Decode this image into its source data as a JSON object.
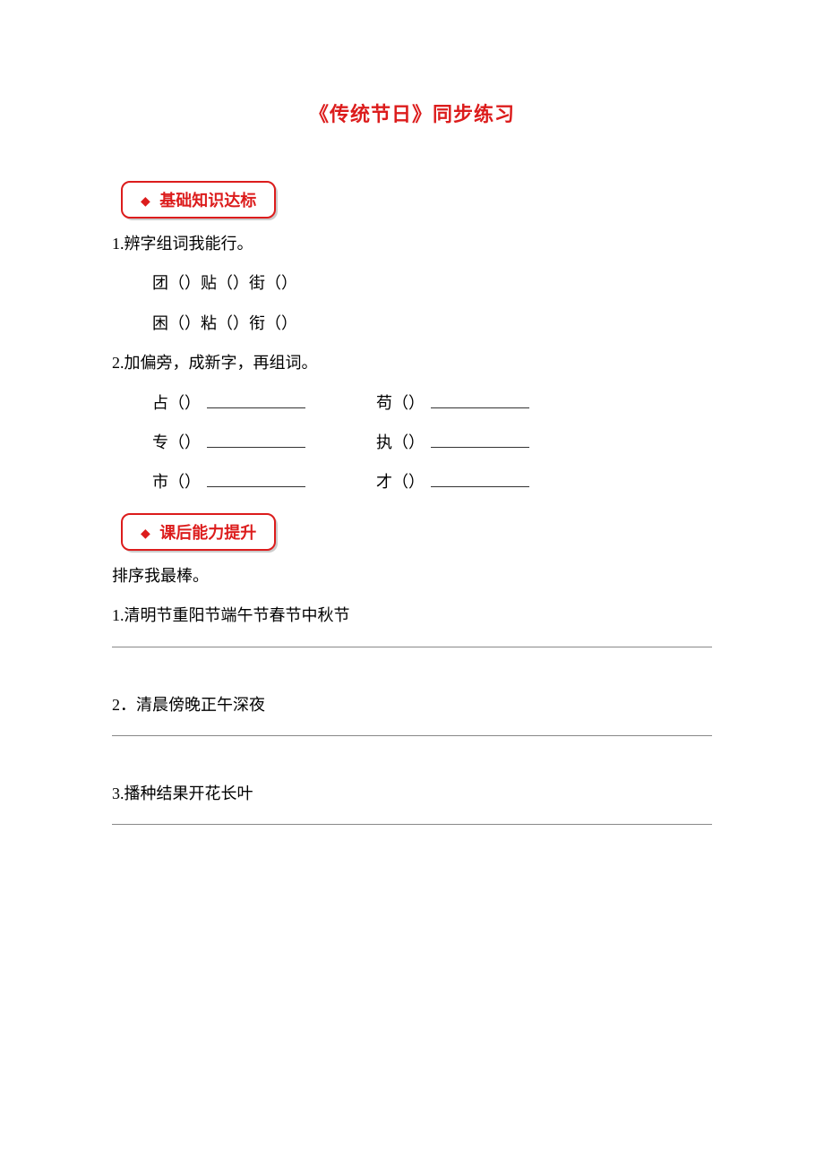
{
  "title": "《传统节日》同步练习",
  "section1": {
    "label": "基础知识达标",
    "q1": {
      "prompt": "1.辨字组词我能行。",
      "line1": "团（）贴（）街（）",
      "line2": "困（）粘（）衔（）"
    },
    "q2": {
      "prompt": "2.加偏旁，成新字，再组词。",
      "pairs": [
        {
          "left": "占（）",
          "right": "苟（）"
        },
        {
          "left": "专（）",
          "right": "执（）"
        },
        {
          "left": "市（）",
          "right": "才（）"
        }
      ]
    }
  },
  "section2": {
    "label": "课后能力提升",
    "intro": "排序我最棒。",
    "items": [
      "1.清明节重阳节端午节春节中秋节",
      "2．清晨傍晚正午深夜",
      "3.播种结果开花长叶"
    ]
  }
}
